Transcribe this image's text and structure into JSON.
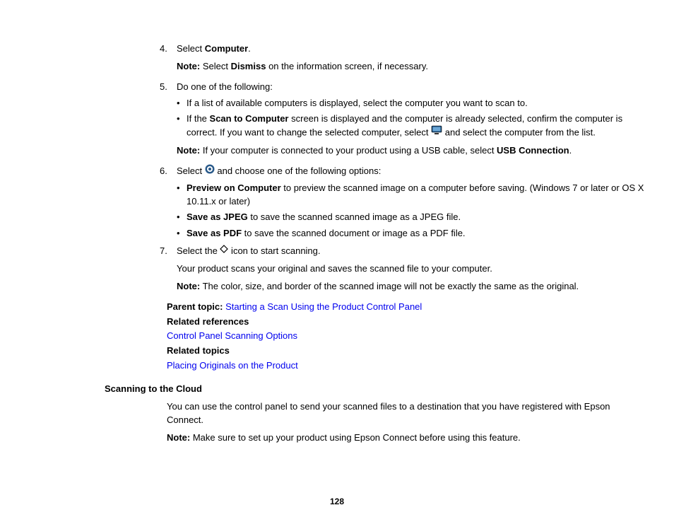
{
  "steps": {
    "s4": {
      "num": "4.",
      "pre": "Select ",
      "bold": "Computer",
      "post": "."
    },
    "s4_note_label": "Note:",
    "s4_note_pre": " Select ",
    "s4_note_bold": "Dismiss",
    "s4_note_post": " on the information screen, if necessary.",
    "s5": {
      "num": "5.",
      "text": "Do one of the following:"
    },
    "s5_b1": "If a list of available computers is displayed, select the computer you want to scan to.",
    "s5_b2_pre": "If the ",
    "s5_b2_bold": "Scan to Computer",
    "s5_b2_mid": " screen is displayed and the computer is already selected, confirm the computer is correct. If you want to change the selected computer, select ",
    "s5_b2_post": " and select the computer from the list.",
    "s5_note_label": "Note:",
    "s5_note_pre": " If your computer is connected to your product using a USB cable, select ",
    "s5_note_bold": "USB Connection",
    "s5_note_post": ".",
    "s6": {
      "num": "6.",
      "pre": "Select ",
      "post": " and choose one of the following options:"
    },
    "s6_b1_bold": "Preview on Computer",
    "s6_b1_post": " to preview the scanned image on a computer before saving. (Windows 7 or later or OS X 10.11.x or later)",
    "s6_b2_bold": "Save as JPEG",
    "s6_b2_post": " to save the scanned scanned image as a JPEG file.",
    "s6_b3_bold": "Save as PDF",
    "s6_b3_post": " to save the scanned document or image as a PDF file.",
    "s7": {
      "num": "7.",
      "pre": "Select the ",
      "post": " icon to start scanning."
    },
    "s7_line2": "Your product scans your original and saves the scanned file to your computer.",
    "s7_note_label": "Note:",
    "s7_note_text": " The color, size, and border of the scanned image will not be exactly the same as the original."
  },
  "refs": {
    "parent_label": "Parent topic:",
    "parent_link": "Starting a Scan Using the Product Control Panel",
    "related_ref_label": "Related references",
    "related_ref_link": "Control Panel Scanning Options",
    "related_top_label": "Related topics",
    "related_top_link": "Placing Originals on the Product"
  },
  "cloud": {
    "heading": "Scanning to the Cloud",
    "para": "You can use the control panel to send your scanned files to a destination that you have registered with Epson Connect.",
    "note_label": "Note:",
    "note_text": " Make sure to set up your product using Epson Connect before using this feature."
  },
  "page_number": "128"
}
